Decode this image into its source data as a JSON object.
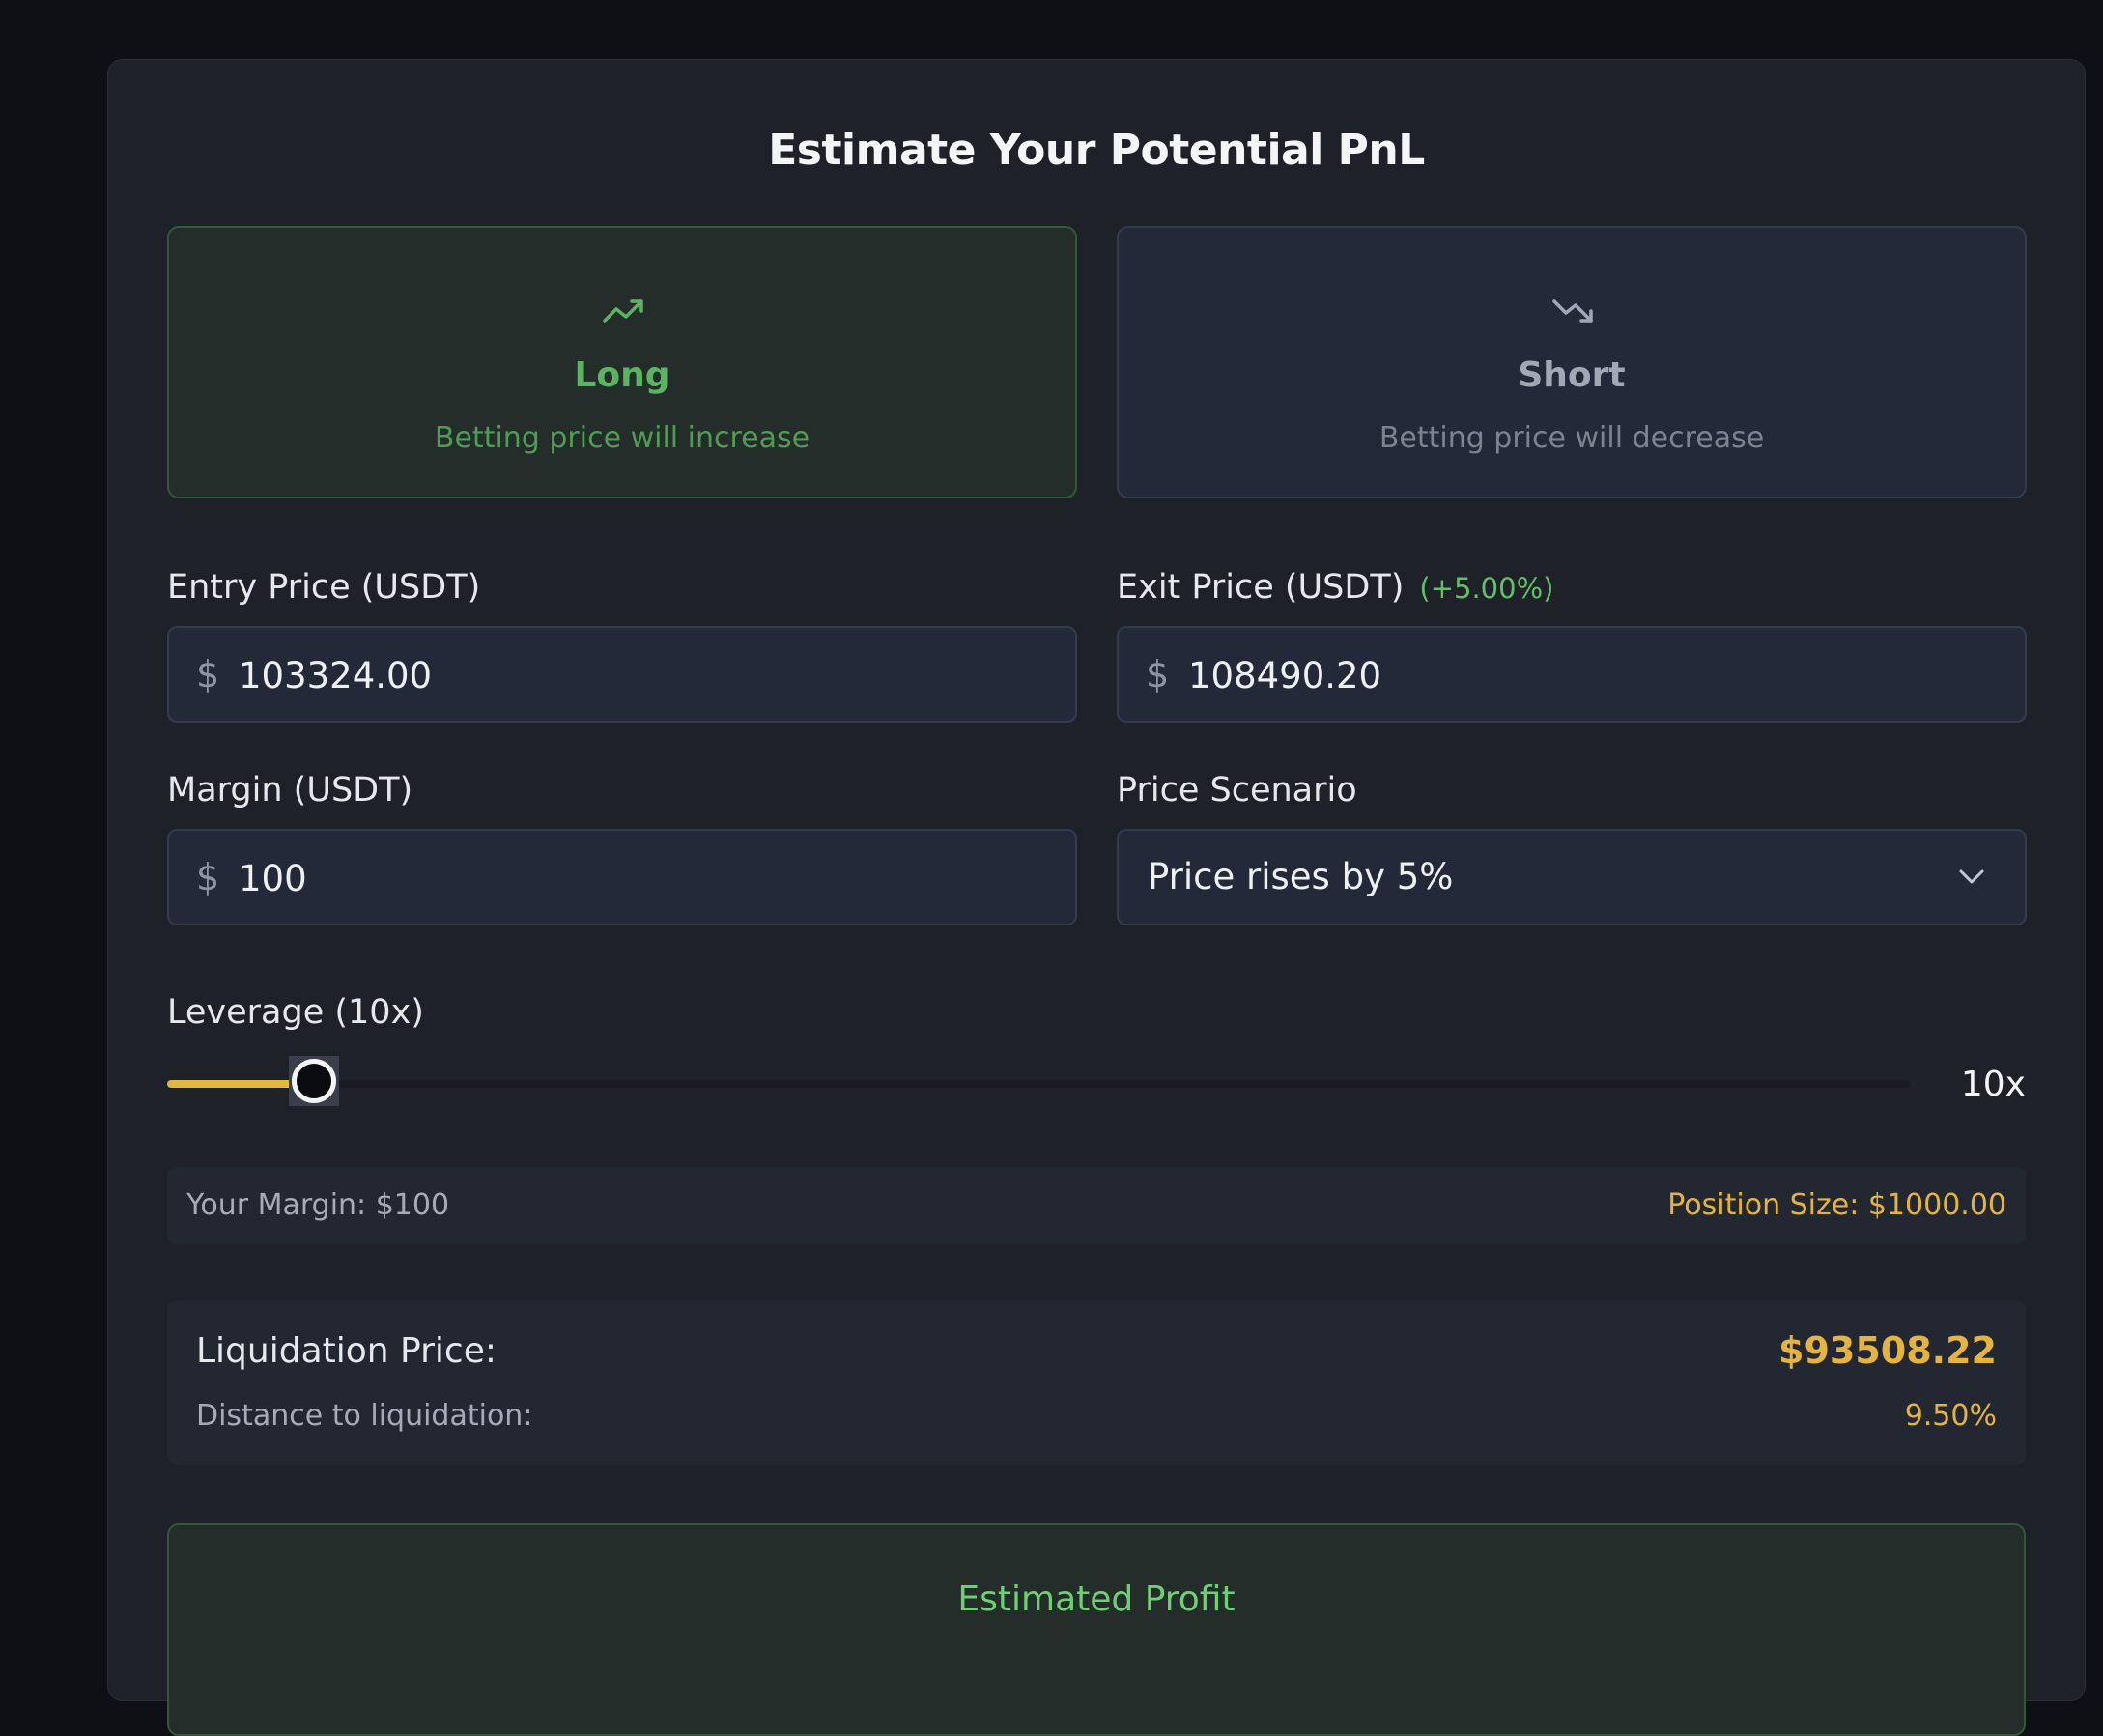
{
  "title": "Estimate Your Potential PnL",
  "direction": {
    "long": {
      "label": "Long",
      "sub": "Betting price will increase",
      "icon": "trending-up-icon",
      "selected": true
    },
    "short": {
      "label": "Short",
      "sub": "Betting price will decrease",
      "icon": "trending-down-icon",
      "selected": false
    }
  },
  "fields": {
    "entry": {
      "label": "Entry Price (USDT)",
      "currency": "$",
      "value": "103324.00"
    },
    "exit": {
      "label": "Exit Price (USDT)",
      "change": "(+5.00%)",
      "currency": "$",
      "value": "108490.20"
    },
    "margin": {
      "label": "Margin (USDT)",
      "currency": "$",
      "value": "100"
    },
    "scenario": {
      "label": "Price Scenario",
      "value": "Price rises by 5%"
    }
  },
  "leverage": {
    "label": "Leverage (10x)",
    "value_text": "10x",
    "fill_fraction": 0.084
  },
  "info": {
    "margin_text": "Your Margin: $100",
    "position_text": "Position Size: $1000.00"
  },
  "liquidation": {
    "label": "Liquidation Price:",
    "price": "$93508.22",
    "distance_label": "Distance to liquidation:",
    "distance": "9.50%"
  },
  "result": {
    "label": "Estimated Profit"
  },
  "colors": {
    "accent_green": "#5ab461",
    "accent_yellow": "#e0b93e",
    "background": "#1f2128"
  }
}
